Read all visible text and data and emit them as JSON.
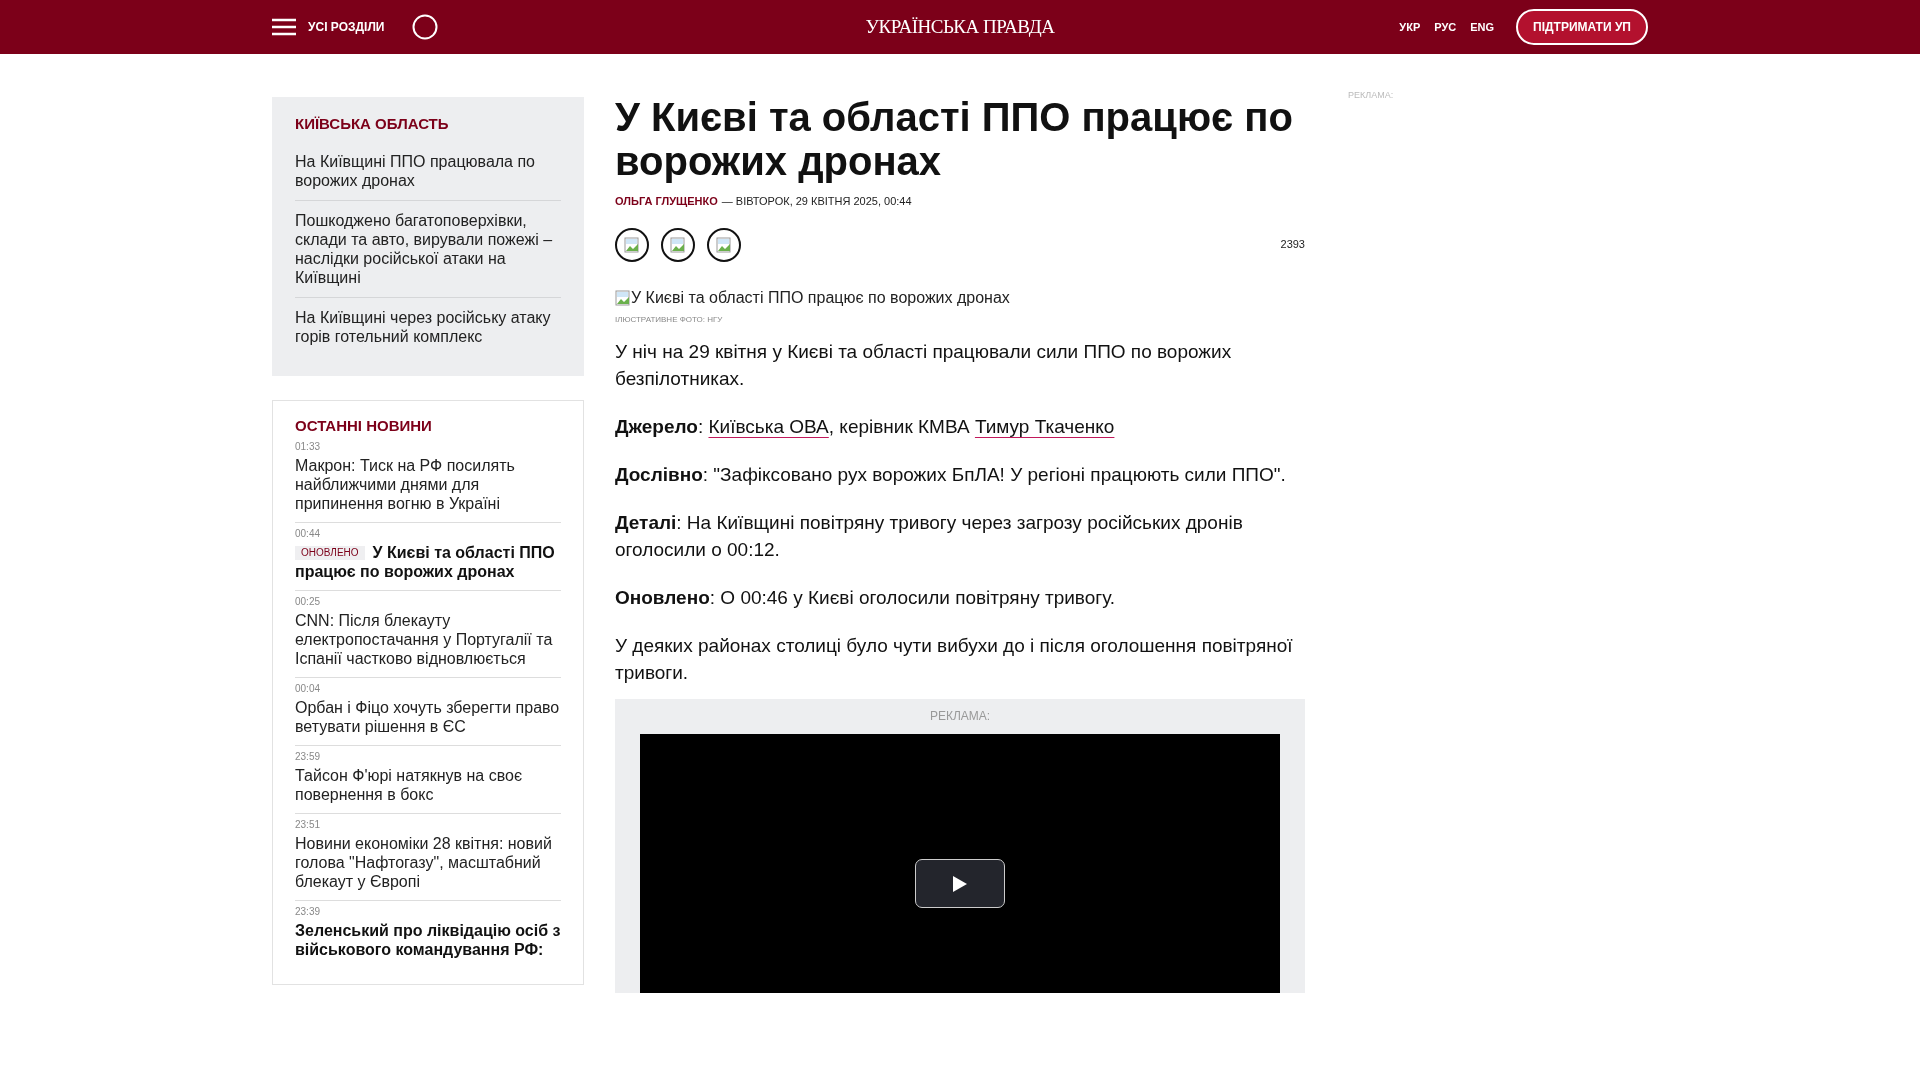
{
  "header": {
    "menu_label": "УСІ РОЗДІЛИ",
    "logo": "УКРАЇНСЬКА ПРАВДА",
    "languages": [
      {
        "label": "УКР"
      },
      {
        "label": "РУС"
      },
      {
        "label": "ENG"
      }
    ],
    "support_button": "ПІДТРИМАТИ УП"
  },
  "region_block": {
    "title": "КИЇВСЬКА ОБЛАСТЬ",
    "items": [
      {
        "title": "На Київщині ППО працювала по ворожих дронах"
      },
      {
        "title": "Пошкоджено багатоповерхівки, склади та авто, вирували пожежі – наслідки російської атаки на Київщині"
      },
      {
        "title": "На Київщині через російську атаку горів готельний комплекс"
      }
    ]
  },
  "latest_news": {
    "title": "ОСТАННІ НОВИНИ",
    "items": [
      {
        "time": "01:33",
        "title": "Макрон: Тиск на РФ посилять найближчими днями для припинення вогню в Україні",
        "important": false
      },
      {
        "time": "00:44",
        "badge": "ОНОВЛЕНО",
        "title": "У Києві та області ППО працює по ворожих дронах",
        "important": true
      },
      {
        "time": "00:25",
        "title": "CNN: Після блекауту електропостачання у Португалії та Іспанії частково відновлюється",
        "important": false
      },
      {
        "time": "00:04",
        "title": "Орбан і Фіцо хочуть зберегти право ветувати рішення в ЄС",
        "important": false
      },
      {
        "time": "23:59",
        "title": "Тайсон Ф'юрі натякнув на своє повернення в бокс",
        "important": false
      },
      {
        "time": "23:51",
        "title": "Новини економіки 28 квітня: новий голова \"Нафтогазу\", масштабний блекаут у Європі",
        "important": false
      },
      {
        "time": "23:39",
        "title": "Зеленський про ліквідацію осіб з військового командування РФ:",
        "important": true
      }
    ]
  },
  "article": {
    "title": "У Києві та області ППО працює по ворожих дронах",
    "author": "ОЛЬГА ГЛУЩЕНКО",
    "date": "— ВІВТОРОК, 29 КВІТНЯ 2025, 00:44",
    "share_count": "2393",
    "image_alt": "У Києві та області ППО працює по ворожих дронах",
    "image_caption": "ІЛЮСТРАТИВНЕ ФОТО: НГУ",
    "paragraphs": [
      [
        {
          "kind": "plain",
          "text": "У ніч на 29 квітня у Києві та області працювали сили ППО по ворожих безпілотниках."
        }
      ],
      [
        {
          "kind": "bold",
          "text": "Джерело"
        },
        {
          "kind": "plain",
          "text": ": "
        },
        {
          "kind": "link",
          "text": "Київська ОВА"
        },
        {
          "kind": "plain",
          "text": ", керівник КМВА "
        },
        {
          "kind": "link",
          "text": "Тимур Ткаченко"
        }
      ],
      [
        {
          "kind": "bold",
          "text": "Дослівно"
        },
        {
          "kind": "plain",
          "text": ": \"Зафіксовано рух ворожих БпЛА! У регіоні працюють сили ППО\"."
        }
      ],
      [
        {
          "kind": "bold",
          "text": "Деталі"
        },
        {
          "kind": "plain",
          "text": ": На Київщині повітряну тривогу через загрозу російських дронів оголосили о 00:12."
        }
      ],
      [
        {
          "kind": "bold",
          "text": "Оновлено"
        },
        {
          "kind": "plain",
          "text": ": О 00:46 у Києві оголосили повітряну тривогу."
        }
      ],
      [
        {
          "kind": "plain",
          "text": "У деяких районах столиці було чути вибухи до і після оголошення повітряної тривоги."
        }
      ]
    ],
    "ad_label": "РЕКЛАМА:"
  },
  "side_ad_label": "РЕКЛАМА:"
}
